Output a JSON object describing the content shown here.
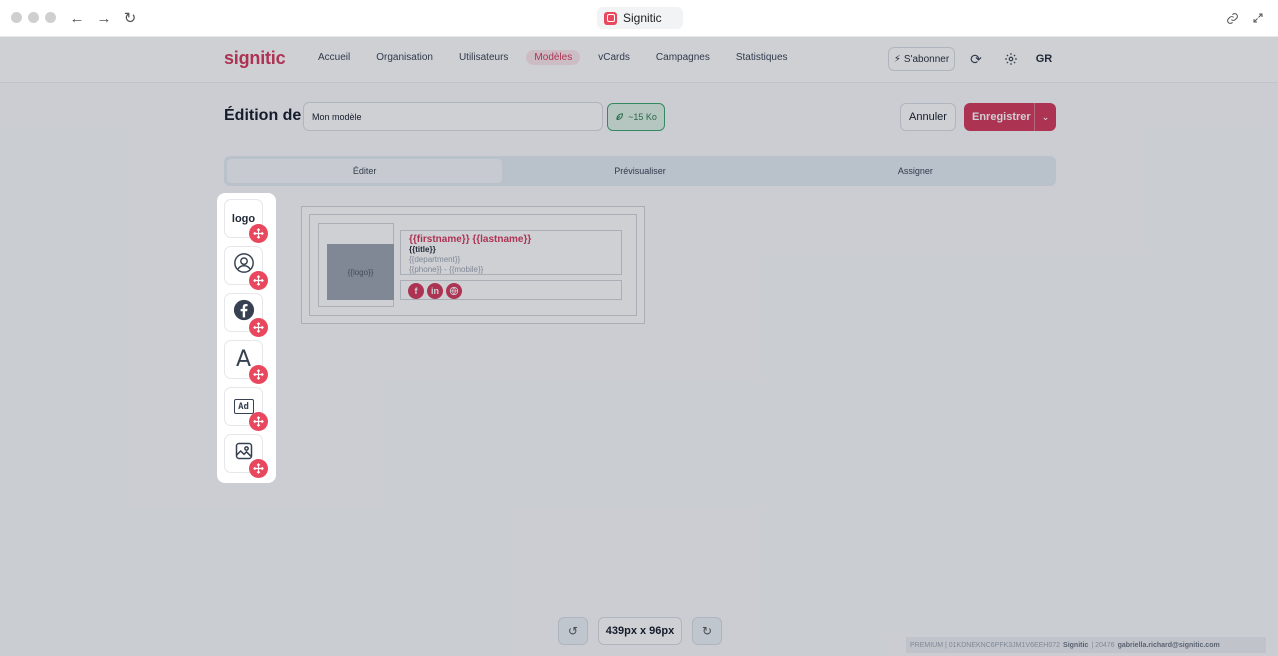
{
  "browser": {
    "tab_title": "Signitic"
  },
  "brand": "signitic",
  "nav": {
    "links": [
      "Accueil",
      "Organisation",
      "Utilisateurs",
      "Modèles",
      "vCards",
      "Campagnes",
      "Statistiques"
    ],
    "active": "Modèles",
    "subscribe_label": "S'abonner",
    "user_initials": "GR"
  },
  "editor": {
    "title": "Édition de",
    "template_name": "Mon modèle",
    "weight_badge": "~15 Ko",
    "cancel_label": "Annuler",
    "save_label": "Enregistrer",
    "tabs": [
      "Éditer",
      "Prévisualiser",
      "Assigner"
    ],
    "active_tab": "Éditer"
  },
  "palette": {
    "items": [
      {
        "name": "logo",
        "label": "logo",
        "icon": "logo-text"
      },
      {
        "name": "profile",
        "label": "",
        "icon": "user-circle-icon"
      },
      {
        "name": "social",
        "label": "",
        "icon": "facebook-icon"
      },
      {
        "name": "text",
        "label": "A",
        "icon": "text-icon"
      },
      {
        "name": "banner",
        "label": "Ad",
        "icon": "ad-icon"
      },
      {
        "name": "image",
        "label": "",
        "icon": "image-icon"
      }
    ]
  },
  "signature": {
    "logo_placeholder": "{{logo}}",
    "name": "{{firstname}} {{lastname}}",
    "title": "{{title}}",
    "department": "{{department}}",
    "phones": "{{phone}} - {{mobile}}",
    "social_icons": [
      "facebook-icon",
      "linkedin-icon",
      "globe-icon"
    ]
  },
  "footer": {
    "dimensions": "439px x 96px",
    "license_prefix": "PREMIUM | 01KDNEKNC6PFK3JM1V6EEH072",
    "license_brand": "Signitic",
    "license_mid": "| 20476",
    "license_email": "gabriella.richard@signitic.com"
  },
  "colors": {
    "accent": "#d5365a",
    "success": "#3ca56c"
  }
}
